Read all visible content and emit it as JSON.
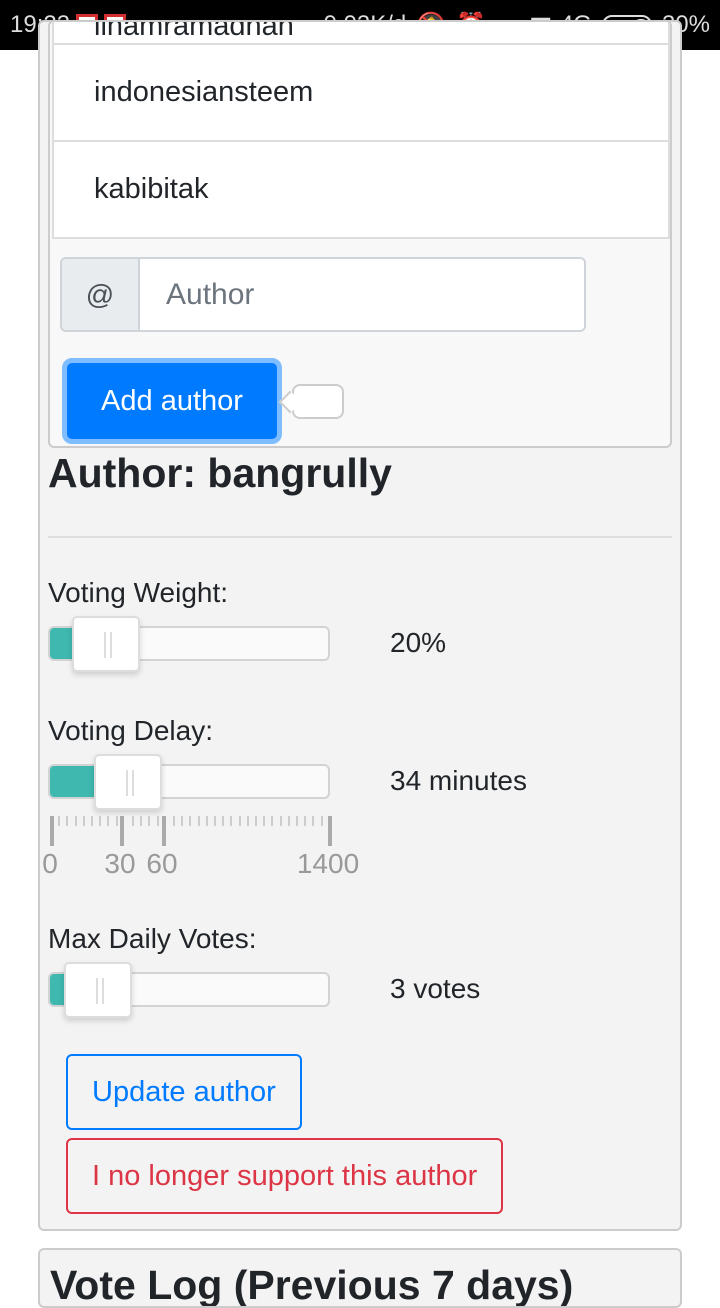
{
  "status_bar": {
    "time": "19:23",
    "notifications": [
      "gmail-icon",
      "gmail-icon"
    ],
    "data_rate": "0,03K/d",
    "network": "4G",
    "battery": "30%"
  },
  "authors_list": [
    "ilhamramadhan",
    "indonesiansteem",
    "kabibitak"
  ],
  "add_author": {
    "prefix": "@",
    "placeholder": "Author",
    "button": "Add author"
  },
  "author": {
    "title": "Author: bangrully",
    "voting_weight": {
      "label": "Voting Weight:",
      "value": "20%",
      "fraction": 0.2
    },
    "voting_delay": {
      "label": "Voting Delay:",
      "value": "34 minutes",
      "minutes": 34,
      "pips": [
        "0",
        "30",
        "60",
        "1400"
      ]
    },
    "max_daily_votes": {
      "label": "Max Daily Votes:",
      "value": "3 votes",
      "votes": 3
    },
    "update_button": "Update author",
    "unsupport_button": "I no longer support this author"
  },
  "vote_log": {
    "title": "Vote Log (Previous 7 days)"
  },
  "colors": {
    "primary": "#007bff",
    "danger": "#dc3545",
    "slider_fill": "#3fb8af"
  }
}
